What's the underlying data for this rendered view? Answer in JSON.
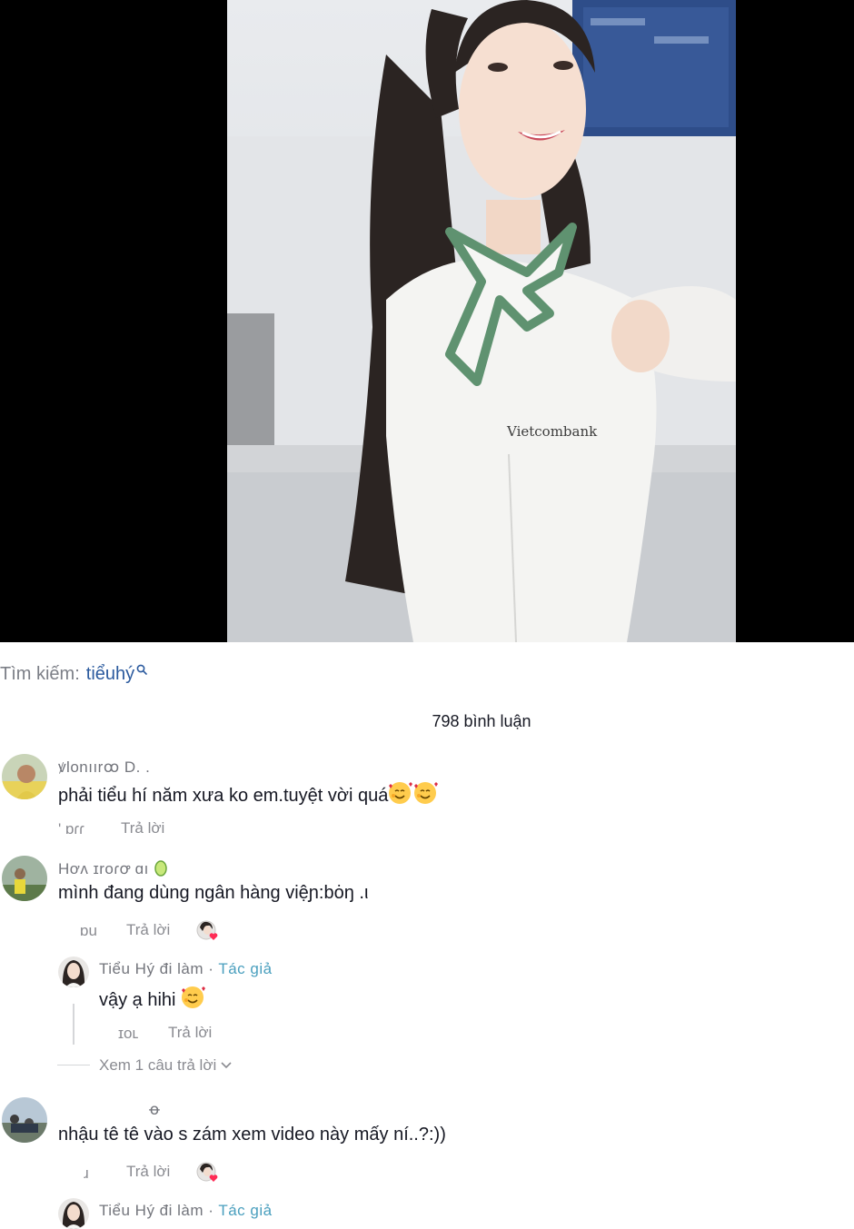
{
  "search": {
    "prefix": "Tìm kiếm:",
    "term": "tiểuhý"
  },
  "comments_header": {
    "count_label": "798 bình luận"
  },
  "comments": [
    {
      "username": "ꝟlonıırꝏ D. .",
      "text": "phải tiểu hí năm xưa ko em.tuyệt vời quá",
      "meta": "' ɒɾɾ",
      "reply_label": "Trả lời"
    },
    {
      "username": "Hơʌ ɪroɾꝍ ɑı",
      "text": "mình đang dùng ngân hàng việɲ:bȯŋ .ι",
      "meta": "ɒu",
      "reply_label": "Trả lời",
      "reply": {
        "username": "Tiểu Hý đi làm",
        "author_tag": "Tác giả",
        "separator": " · ",
        "text": "vậy ạ hihi",
        "meta": "ɪoʟ",
        "reply_label": "Trả lời"
      },
      "view_more_label": "Xem 1 câu trả lời"
    },
    {
      "username": "ꝋ",
      "text": "nhậu tê tê vào s zám xem video này mấy ní..?:))",
      "meta": "ɹ",
      "reply_label": "Trả lời",
      "reply": {
        "username": "Tiểu Hý đi làm",
        "author_tag": "Tác giả",
        "separator": " · "
      }
    }
  ],
  "colors": {
    "author_tag": "#4a9fbe",
    "search_term": "#2b5a9e",
    "muted_text": "#8a8b91",
    "like_heart": "#fe2c55"
  }
}
